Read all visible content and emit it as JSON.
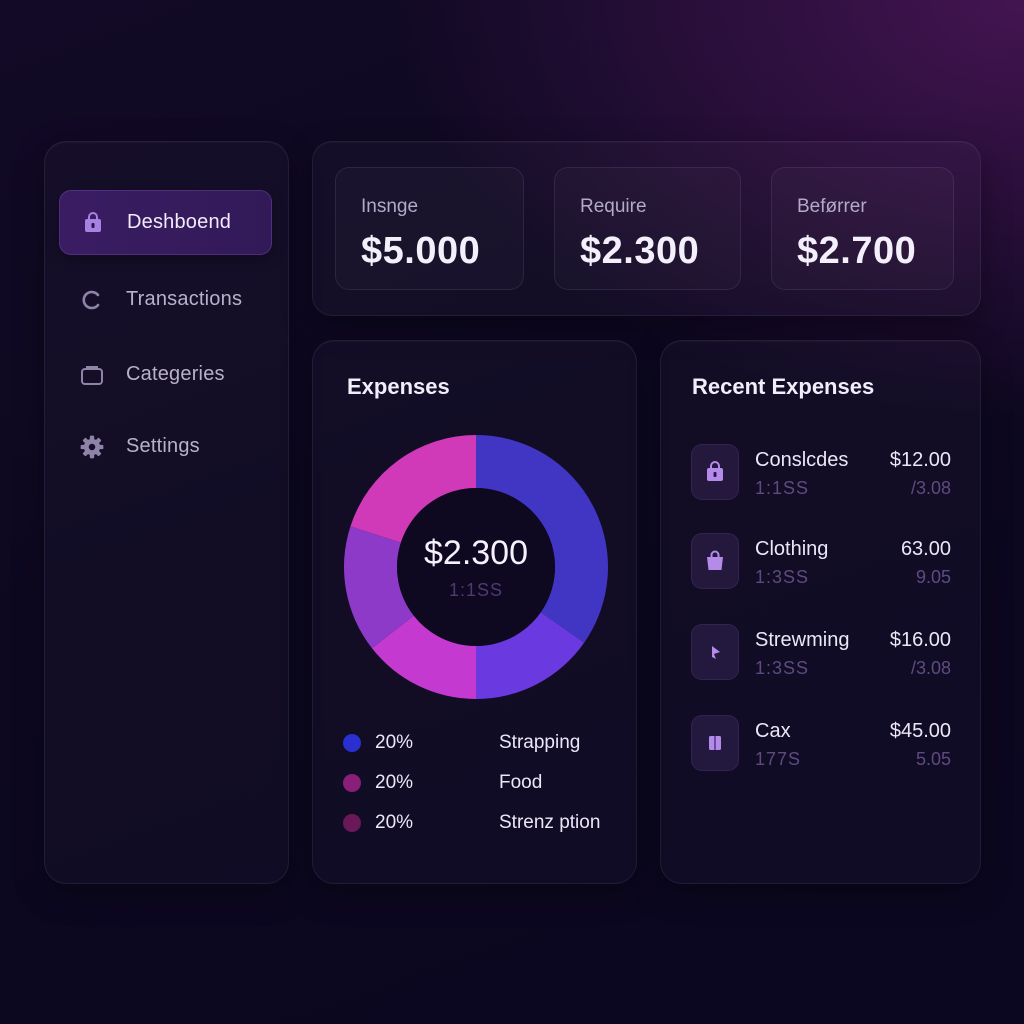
{
  "sidebar": {
    "items": [
      {
        "label": "Deshboend",
        "icon": "lock-bag-icon",
        "active": true
      },
      {
        "label": "Transactions",
        "icon": "refresh-icon",
        "active": false
      },
      {
        "label": "Categeries",
        "icon": "folder-icon",
        "active": false
      },
      {
        "label": "Settings",
        "icon": "gear-icon",
        "active": false
      }
    ]
  },
  "summary": {
    "cards": [
      {
        "label": "Insnge",
        "value": "$5.000"
      },
      {
        "label": "Require",
        "value": "$2.300"
      },
      {
        "label": "Beførrer",
        "value": "$2.700"
      }
    ]
  },
  "expenses": {
    "title": "Expenses",
    "center_value": "$2.300",
    "center_sub": "1:1SS",
    "legend": [
      {
        "pct": "20%",
        "name": "Strapping",
        "color": "#2a2fd0"
      },
      {
        "pct": "20%",
        "name": "Food",
        "color": "#8a1f7a"
      },
      {
        "pct": "20%",
        "name": "Strenz ption",
        "color": "#6a1858"
      }
    ]
  },
  "chart_data": {
    "type": "pie",
    "segment_colors": [
      "#4136c4",
      "#6a3ae0",
      "#c43ad0",
      "#8e3ac8",
      "#d03ab8"
    ]
  },
  "recent": {
    "title": "Recent Expenses",
    "items": [
      {
        "name": "Conslcdes",
        "sub": "1:1SS",
        "amount": "$12.00",
        "sub_amount": "/3.08",
        "icon": "bag-icon"
      },
      {
        "name": "Clothing",
        "sub": "1:3SS",
        "amount": "63.00",
        "sub_amount": "9.05",
        "icon": "shopping-bag-icon"
      },
      {
        "name": "Strewming",
        "sub": "1:3SS",
        "amount": "$16.00",
        "sub_amount": "/3.08",
        "icon": "play-icon"
      },
      {
        "name": "Cax",
        "sub": "177S",
        "amount": "$45.00",
        "sub_amount": "5.05",
        "icon": "card-icon"
      }
    ]
  }
}
